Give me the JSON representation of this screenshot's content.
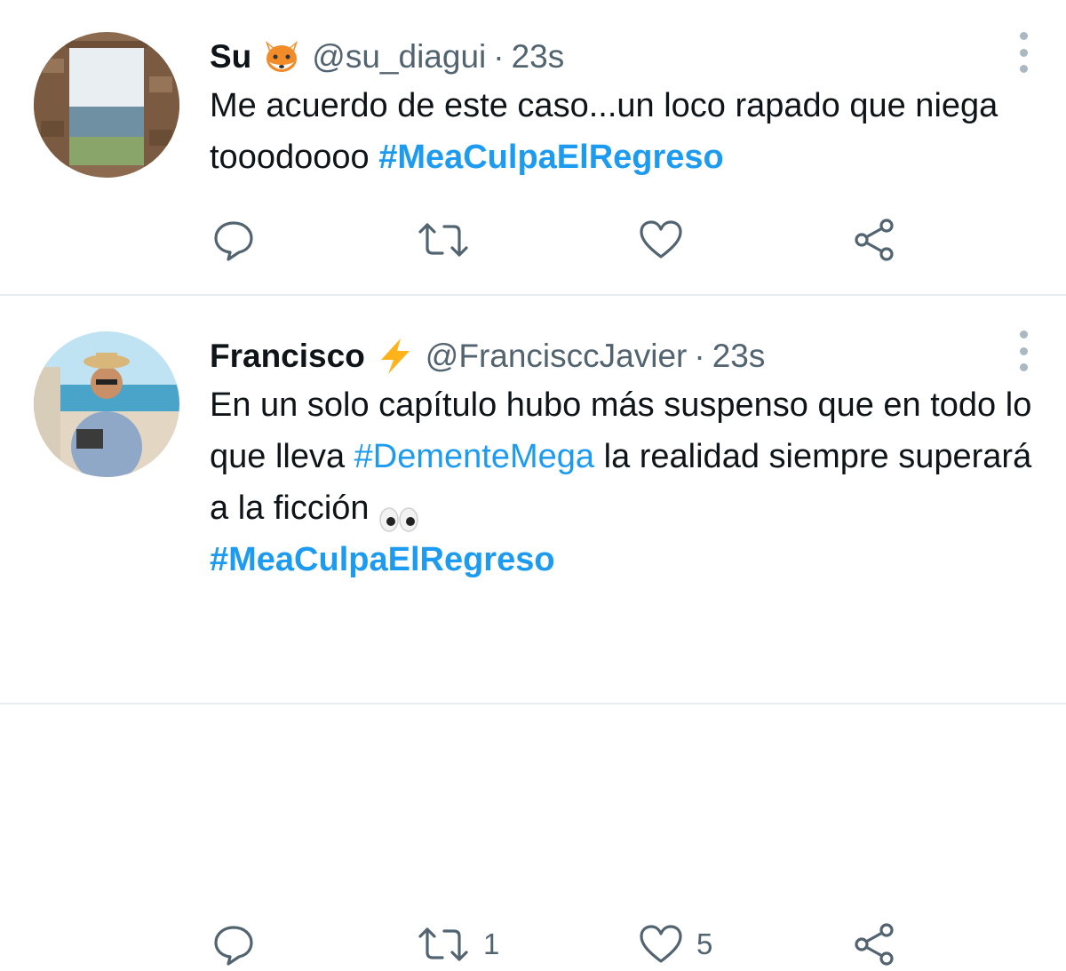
{
  "tweets": [
    {
      "name": "Su",
      "emoji": "fox-face",
      "handle": "@su_diagui",
      "separator": "·",
      "time": "23s",
      "text_parts": [
        {
          "text": "Me acuerdo de este caso...un loco rapado que niega tooodoooo "
        },
        {
          "text": "#MeaCulpaElRegreso",
          "hashtag": true,
          "bold": true
        }
      ],
      "actions": {
        "reply": "",
        "retweet": "",
        "like": "",
        "share": ""
      }
    },
    {
      "name": "Francisco",
      "emoji": "high-voltage",
      "handle": "@FranciscсJavier",
      "separator": "·",
      "time": "23s",
      "text_parts": [
        {
          "text": "En un solo capítulo hubo más suspenso que en todo lo que lleva "
        },
        {
          "text": "#DementeMega",
          "hashtag": true,
          "bold": false
        },
        {
          "text": "  la realidad siempre superará a la ficción "
        },
        {
          "text": "#MeaCulpaElRegreso",
          "hashtag": true,
          "bold": true
        }
      ],
      "actions": {
        "reply": "",
        "retweet": "1",
        "like": "5",
        "share": ""
      }
    }
  ],
  "icons": {
    "reply": "speech-bubble-icon",
    "retweet": "retweet-arrows-icon",
    "like": "heart-icon",
    "share": "share-nodes-icon",
    "more": "vertical-ellipsis-icon",
    "eyes": "eyes-emoji"
  },
  "colors": {
    "hashtag": "#1d9bf0",
    "secondary_text": "#536471",
    "divider": "#e6ecf0"
  }
}
